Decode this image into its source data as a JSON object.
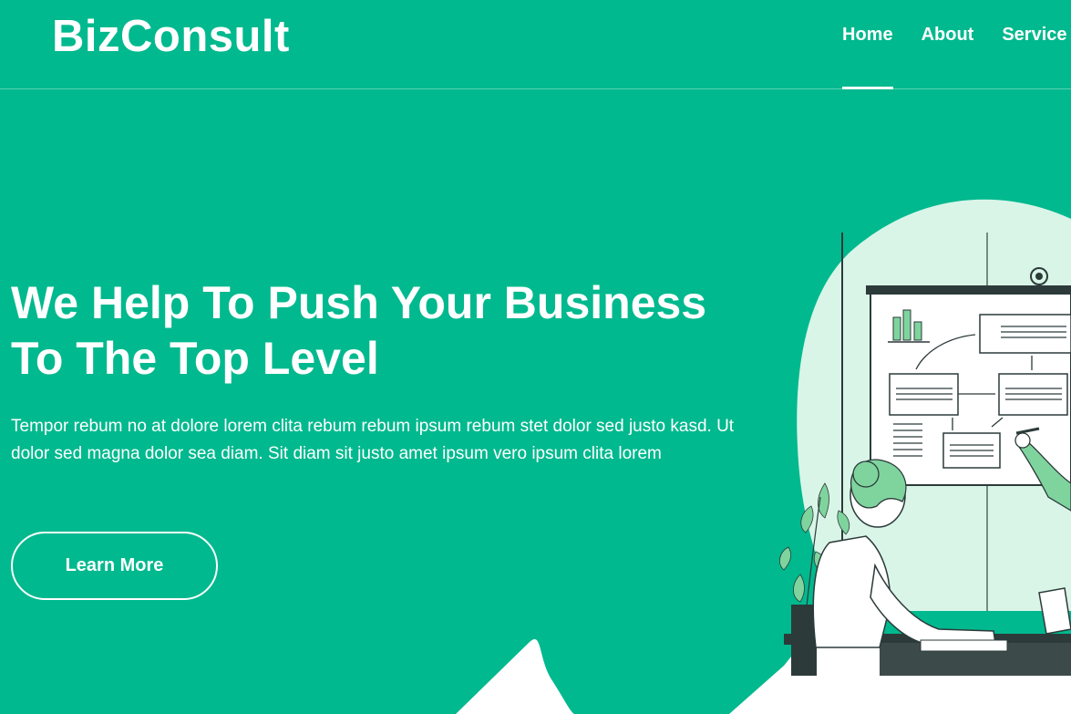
{
  "navbar": {
    "brand": "BizConsult",
    "links": [
      {
        "label": "Home",
        "active": true
      },
      {
        "label": "About",
        "active": false
      },
      {
        "label": "Service",
        "active": false
      }
    ]
  },
  "hero": {
    "title_line1": "We Help To Push Your Business",
    "title_line2": "To The Top Level",
    "text": "Tempor rebum no at dolore lorem clita rebum rebum ipsum rebum stet dolor sed justo kasd. Ut dolor sed magna dolor sea diam. Sit diam sit justo amet ipsum vero ipsum clita lorem",
    "button_label": "Learn More"
  },
  "colors": {
    "primary": "#00b98e",
    "light_accent": "#d9f5e8",
    "illustration_green": "#7fd49e"
  },
  "illustration": {
    "icon": "business-meeting-illustration"
  }
}
